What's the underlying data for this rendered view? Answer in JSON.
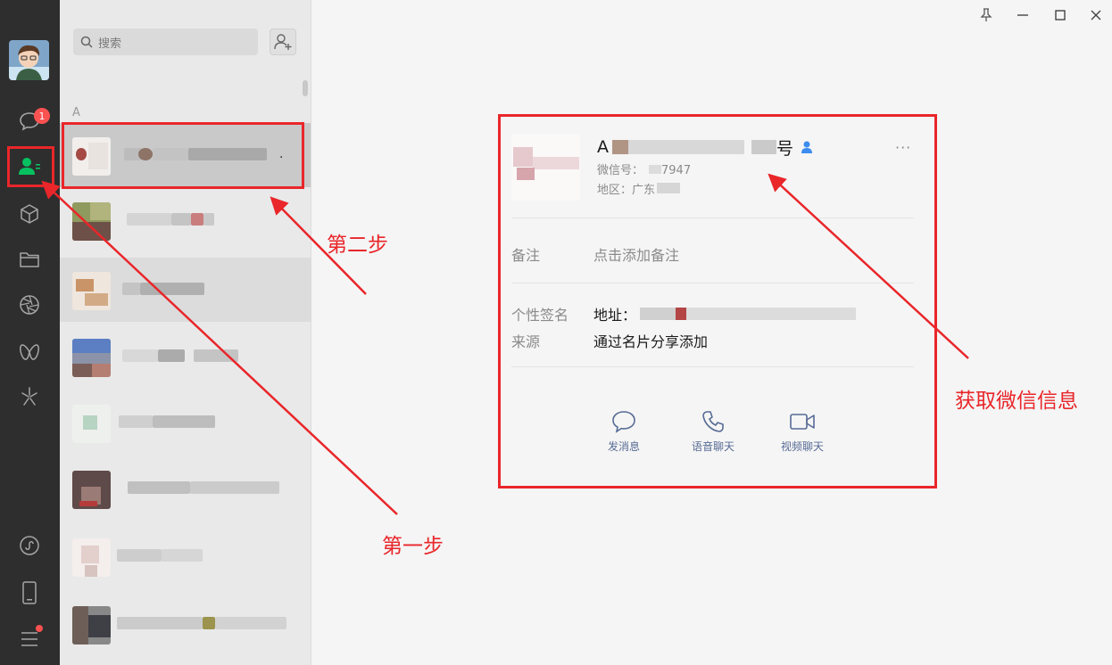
{
  "sidebar": {
    "badge_count": "1",
    "icons": [
      "chat-icon",
      "contacts-icon",
      "favorites-cube-icon",
      "folder-icon",
      "moments-aperture-icon",
      "channels-butterfly-icon",
      "discover-sparkle-icon",
      "mini-program-icon",
      "phone-icon",
      "menu-icon"
    ]
  },
  "list": {
    "search_placeholder": "搜索",
    "section_letter": "A",
    "selected_name_tail": "."
  },
  "profile": {
    "name_prefix": "A",
    "name_suffix": "号",
    "wechat_id_label": "微信号：",
    "wechat_id_tail": "7947",
    "region_label": "地区：广东",
    "remark_label": "备注",
    "remark_value": "点击添加备注",
    "signature_label": "个性签名",
    "signature_value_prefix": "地址：",
    "source_label": "来源",
    "source_value": "通过名片分享添加",
    "actions": [
      {
        "label": "发消息"
      },
      {
        "label": "语音聊天"
      },
      {
        "label": "视频聊天"
      }
    ]
  },
  "annotations": {
    "step1": "第一步",
    "step2": "第二步",
    "get_info": "获取微信信息"
  },
  "colors": {
    "accent_green": "#07c160",
    "annotation_red": "#e9262a",
    "link_blue": "#576b95"
  }
}
